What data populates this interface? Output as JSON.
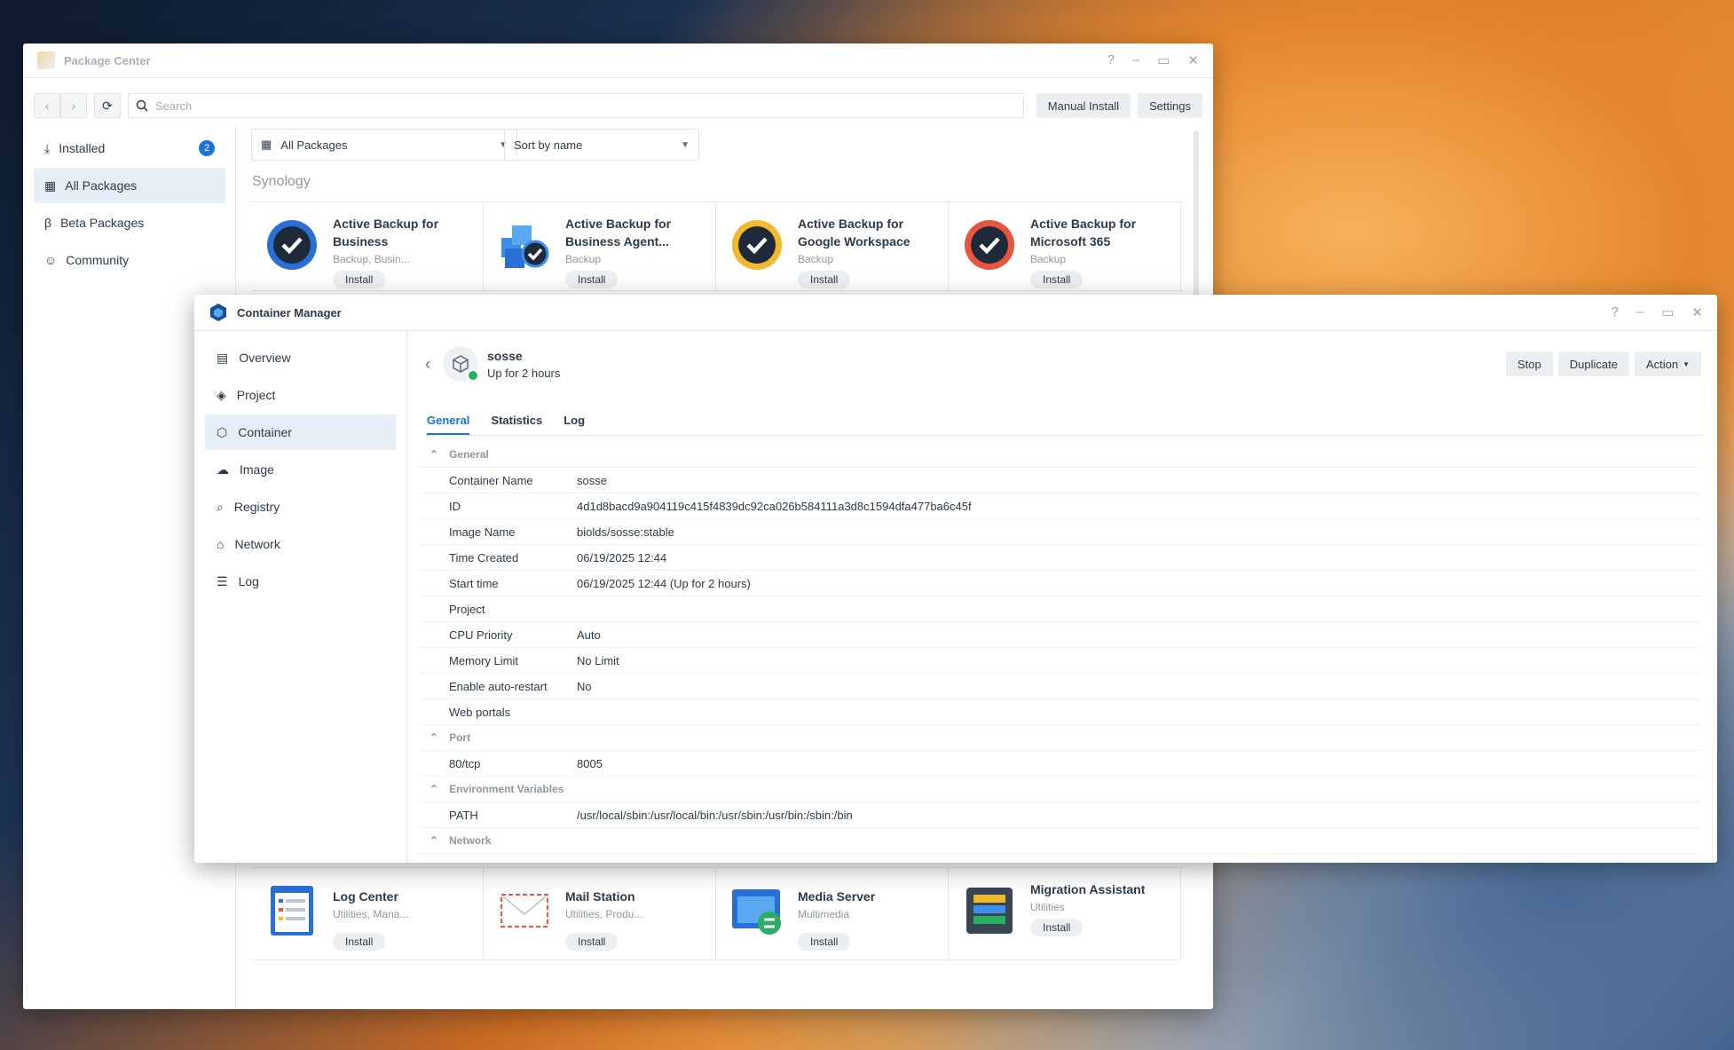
{
  "package_center": {
    "title": "Package Center",
    "search_placeholder": "Search",
    "manual_install_label": "Manual Install",
    "settings_label": "Settings",
    "sidebar": [
      {
        "label": "Installed",
        "badge": "2"
      },
      {
        "label": "All Packages"
      },
      {
        "label": "Beta Packages"
      },
      {
        "label": "Community"
      }
    ],
    "filter_value": "All Packages",
    "sort_value": "Sort by name",
    "section_title": "Synology",
    "top_cards": [
      {
        "title": "Active Backup for Business",
        "sub": "Backup, Busin...",
        "button": "Install"
      },
      {
        "title": "Active Backup for Business Agent...",
        "sub": "Backup",
        "button": "Install"
      },
      {
        "title": "Active Backup for Google Workspace",
        "sub": "Backup",
        "button": "Install"
      },
      {
        "title": "Active Backup for Microsoft 365",
        "sub": "Backup",
        "button": "Install"
      }
    ],
    "bottom_cards": [
      {
        "title": "Log Center",
        "sub": "Utilities, Mana...",
        "button": "Install"
      },
      {
        "title": "Mail Station",
        "sub": "Utilities, Produ...",
        "button": "Install"
      },
      {
        "title": "Media Server",
        "sub": "Multimedia",
        "button": "Install"
      },
      {
        "title": "Migration Assistant",
        "sub": "Utilities",
        "button": "Install"
      }
    ]
  },
  "container_manager": {
    "title": "Container Manager",
    "sidebar": [
      {
        "label": "Overview"
      },
      {
        "label": "Project"
      },
      {
        "label": "Container"
      },
      {
        "label": "Image"
      },
      {
        "label": "Registry"
      },
      {
        "label": "Network"
      },
      {
        "label": "Log"
      }
    ],
    "container_name": "sosse",
    "container_status": "Up for 2 hours",
    "buttons": {
      "stop": "Stop",
      "duplicate": "Duplicate",
      "action": "Action"
    },
    "tabs": [
      "General",
      "Statistics",
      "Log"
    ],
    "groups": {
      "general": {
        "label": "General",
        "rows": [
          {
            "key": "Container Name",
            "value": "sosse"
          },
          {
            "key": "ID",
            "value": "4d1d8bacd9a904119c415f4839dc92ca026b584111a3d8c1594dfa477ba6c45f"
          },
          {
            "key": "Image Name",
            "value": "biolds/sosse:stable"
          },
          {
            "key": "Time Created",
            "value": "06/19/2025 12:44"
          },
          {
            "key": "Start time",
            "value": "06/19/2025 12:44 (Up for 2 hours)"
          },
          {
            "key": "Project",
            "value": ""
          },
          {
            "key": "CPU Priority",
            "value": "Auto"
          },
          {
            "key": "Memory Limit",
            "value": "No Limit"
          },
          {
            "key": "Enable auto-restart",
            "value": "No"
          },
          {
            "key": "Web portals",
            "value": ""
          }
        ]
      },
      "port": {
        "label": "Port",
        "rows": [
          {
            "key": "80/tcp",
            "value": "8005"
          }
        ]
      },
      "env": {
        "label": "Environment Variables",
        "rows": [
          {
            "key": "PATH",
            "value": "/usr/local/sbin:/usr/local/bin:/usr/sbin:/usr/bin:/sbin:/bin"
          }
        ]
      },
      "network": {
        "label": "Network"
      }
    }
  }
}
